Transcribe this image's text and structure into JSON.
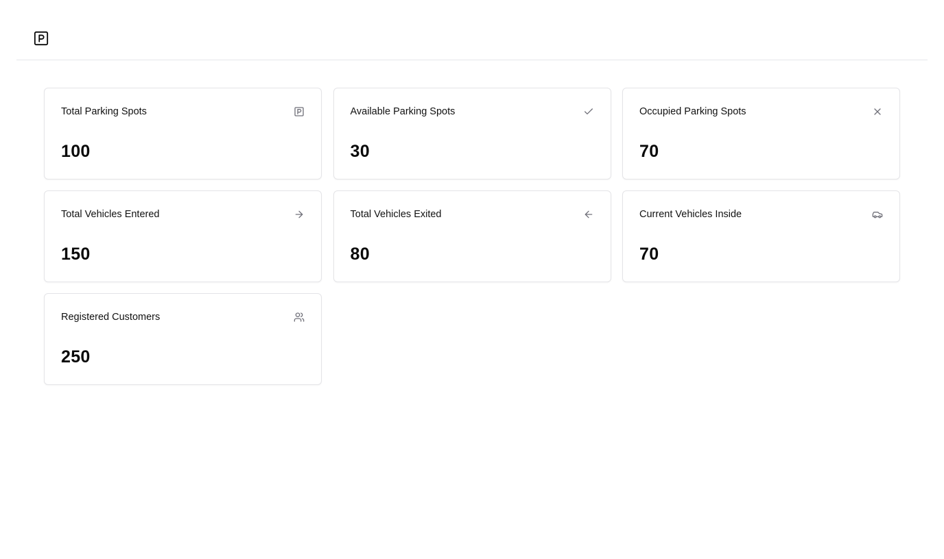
{
  "header": {
    "logo_icon": "parking-square-icon"
  },
  "cards": [
    {
      "title": "Total Parking Spots",
      "value": "100",
      "icon": "parking-square-icon"
    },
    {
      "title": "Available Parking Spots",
      "value": "30",
      "icon": "check-icon"
    },
    {
      "title": "Occupied Parking Spots",
      "value": "70",
      "icon": "close-icon"
    },
    {
      "title": "Total Vehicles Entered",
      "value": "150",
      "icon": "arrow-right-icon"
    },
    {
      "title": "Total Vehicles Exited",
      "value": "80",
      "icon": "arrow-left-icon"
    },
    {
      "title": "Current Vehicles Inside",
      "value": "70",
      "icon": "car-icon"
    },
    {
      "title": "Registered Customers",
      "value": "250",
      "icon": "users-icon"
    }
  ],
  "colors": {
    "border": "#e4e4e7",
    "icon": "#71717a",
    "text": "#0a0a0a"
  }
}
